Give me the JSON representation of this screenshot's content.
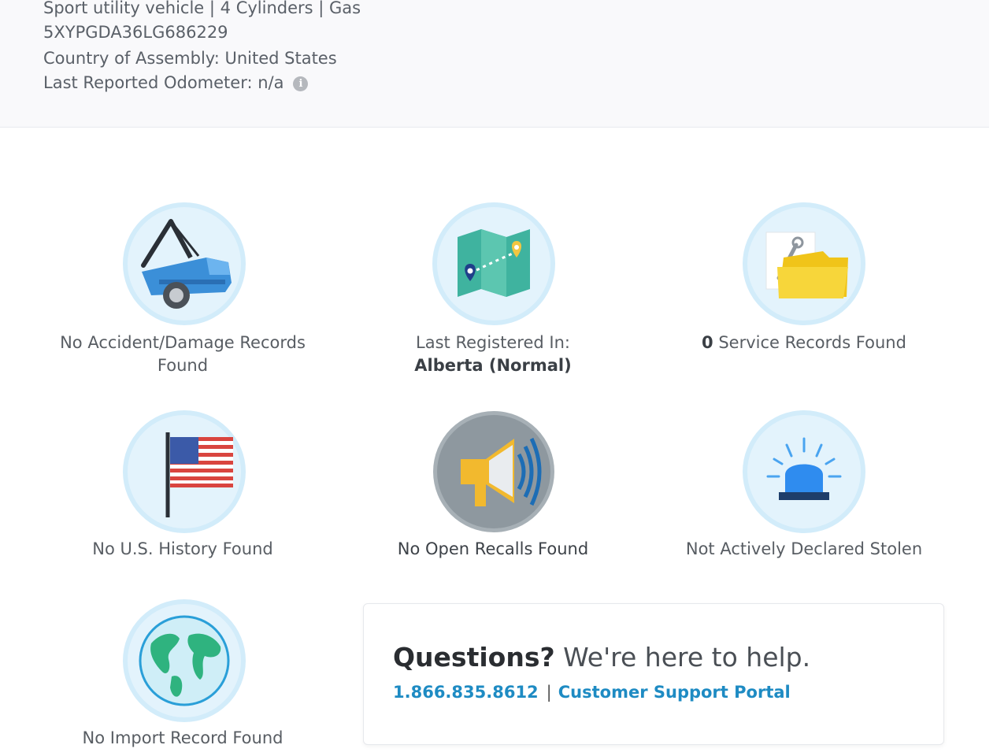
{
  "vehicle": {
    "type_line": "Sport utility vehicle | 4 Cylinders | Gas",
    "vin": "5XYPGDA36LG686229",
    "assembly": "Country of Assembly: United States",
    "odometer": "Last Reported Odometer: n/a",
    "info_icon": "i"
  },
  "cards": {
    "accident": {
      "line1": "No Accident/Damage Records",
      "line2": "Found",
      "icon": "tow-truck-icon"
    },
    "registration": {
      "line1": "Last Registered In:",
      "line2": "Alberta (Normal)",
      "icon": "map-icon"
    },
    "service": {
      "count": "0",
      "text": " Service Records Found",
      "icon": "folder-wrench-icon"
    },
    "us_history": {
      "text": "No U.S. History Found",
      "icon": "us-flag-icon"
    },
    "recalls": {
      "text": "No Open Recalls Found",
      "icon": "megaphone-icon"
    },
    "stolen": {
      "text": "Not Actively Declared Stolen",
      "icon": "police-siren-icon"
    },
    "import": {
      "text": "No Import Record Found",
      "icon": "globe-icon"
    }
  },
  "help": {
    "title_bold": "Questions?",
    "title_rest": " We're here to help.",
    "phone": "1.866.835.8612",
    "separator": "|",
    "portal": "Customer Support Portal"
  },
  "colors": {
    "link": "#1e8bc3",
    "circle_bg": "#e3f3fc",
    "recall_bg": "#8e989f"
  }
}
